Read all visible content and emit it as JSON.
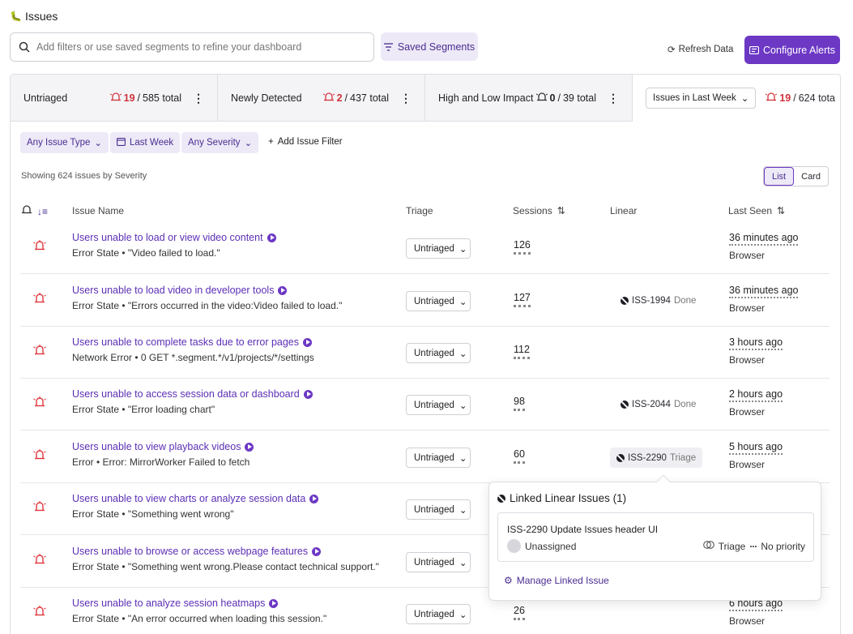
{
  "page": {
    "title": "Issues"
  },
  "search": {
    "placeholder": "Add filters or use saved segments to refine your dashboard"
  },
  "saved_segments_label": "Saved Segments",
  "refresh_label": "Refresh Data",
  "configure_alerts_label": "Configure Alerts",
  "segments": [
    {
      "label": "Untriaged",
      "count": "19",
      "total": "585 total"
    },
    {
      "label": "Newly Detected",
      "count": "2",
      "total": "437 total"
    },
    {
      "label": "High and Low Impact",
      "count": "0",
      "total": "39 total"
    }
  ],
  "week_segment": {
    "select_value": "Issues in Last Week",
    "count": "19",
    "total": "624 tota"
  },
  "filters": {
    "issue_type": "Any Issue Type",
    "period": "Last Week",
    "severity": "Any Severity",
    "add_label": "Add Issue Filter"
  },
  "summary": "Showing 624 issues by Severity",
  "view": {
    "list": "List",
    "card": "Card",
    "selected": "List"
  },
  "columns": {
    "issue_name": "Issue Name",
    "triage": "Triage",
    "sessions": "Sessions",
    "linear": "Linear",
    "last_seen": "Last Seen"
  },
  "accent_color": "#6c38c4",
  "severity_color": "#e0383e",
  "issues": [
    {
      "title": "Users unable to load or view video content",
      "desc": "Error State • \"Video failed to load.\"",
      "triage": "Untriaged",
      "sessions": "126",
      "linear_id": "",
      "linear_status": "",
      "last_seen": "36 minutes ago",
      "source": "Browser"
    },
    {
      "title": "Users unable to load video in developer tools",
      "desc": "Error State • \"Errors occurred in the video:Video failed to load.\"",
      "triage": "Untriaged",
      "sessions": "127",
      "linear_id": "ISS-1994",
      "linear_status": "Done",
      "last_seen": "36 minutes ago",
      "source": "Browser"
    },
    {
      "title": "Users unable to complete tasks due to error pages",
      "desc": "Network Error • 0 GET *.segment.*/v1/projects/*/settings",
      "triage": "Untriaged",
      "sessions": "112",
      "linear_id": "",
      "linear_status": "",
      "last_seen": "3 hours ago",
      "source": "Browser"
    },
    {
      "title": "Users unable to access session data or dashboard",
      "desc": "Error State • \"Error loading chart\"",
      "triage": "Untriaged",
      "sessions": "98",
      "linear_id": "ISS-2044",
      "linear_status": "Done",
      "last_seen": "2 hours ago",
      "source": "Browser"
    },
    {
      "title": "Users unable to view playback videos",
      "desc": "Error • Error: MirrorWorker Failed to fetch",
      "triage": "Untriaged",
      "sessions": "60",
      "linear_id": "ISS-2290",
      "linear_status": "Triage",
      "last_seen": "5 hours ago",
      "source": "Browser"
    },
    {
      "title": "Users unable to view charts or analyze session data",
      "desc": "Error State • \"Something went wrong\"",
      "triage": "Untriaged",
      "sessions": "",
      "linear_id": "",
      "linear_status": "",
      "last_seen": "",
      "source": ""
    },
    {
      "title": "Users unable to browse or access webpage features",
      "desc": "Error State • \"Something went wrong.Please contact technical support.\"",
      "triage": "Untriaged",
      "sessions": "",
      "linear_id": "",
      "linear_status": "",
      "last_seen": "",
      "source": ""
    },
    {
      "title": "Users unable to analyze session heatmaps",
      "desc": "Error State • \"An error occurred when loading this session.\"",
      "triage": "Untriaged",
      "sessions": "26",
      "linear_id": "",
      "linear_status": "",
      "last_seen": "6 hours ago",
      "source": "Browser"
    }
  ],
  "popover": {
    "title": "Linked Linear Issues (1)",
    "issue_id": "ISS-2290",
    "issue_title": "Update Issues header UI",
    "assignee": "Unassigned",
    "status": "Triage",
    "priority": "No priority",
    "manage_label": "Manage Linked Issue"
  }
}
